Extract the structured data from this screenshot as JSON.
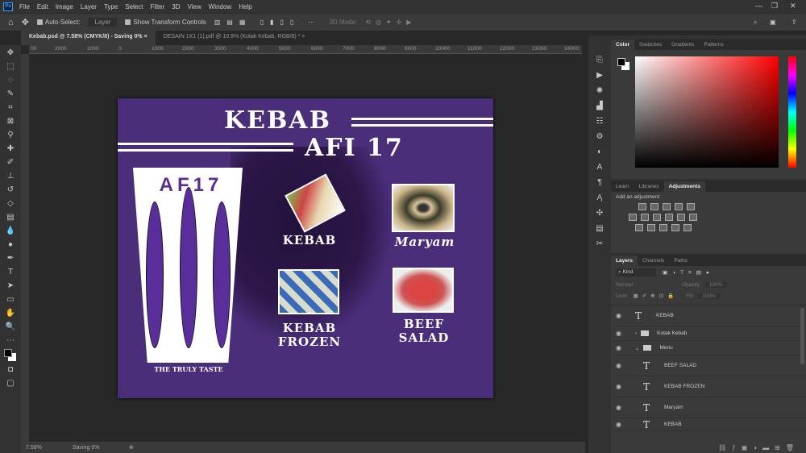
{
  "menubar": {
    "logo": "Ps",
    "items": [
      "File",
      "Edit",
      "Image",
      "Layer",
      "Type",
      "Select",
      "Filter",
      "3D",
      "View",
      "Window",
      "Help"
    ]
  },
  "options": {
    "auto_select": "Auto-Select:",
    "auto_select_target": "Layer",
    "show_transform": "Show Transform Controls",
    "mode_3d": "3D Mode:"
  },
  "tabs": [
    {
      "label": "Kebab.psd @ 7.58% (CMYK/8) - Saving 0%",
      "active": true
    },
    {
      "label": "DESAIN 1X1 (1).pdf @ 10.9% (Kotak Kebab, RGB/8) *",
      "active": false
    }
  ],
  "ruler": [
    "00",
    "2000",
    "1000",
    "0",
    "1000",
    "2000",
    "3000",
    "4000",
    "5000",
    "6000",
    "7000",
    "8000",
    "9000",
    "10000",
    "11000",
    "12000",
    "13000",
    "14000"
  ],
  "document": {
    "title_line1": "KEBAB",
    "title_line2": "AFI 17",
    "logo_text": "AF17",
    "tagline": "THE TRULY TASTE",
    "menu": [
      "KEBAB",
      "Maryam",
      "KEBAB FROZEN",
      "BEEF SALAD"
    ],
    "bg_color": "#4a2e7a"
  },
  "status": {
    "zoom": "7.58%",
    "saving": "Saving 0%"
  },
  "color_panel": {
    "tabs": [
      "Color",
      "Swatches",
      "Gradients",
      "Patterns"
    ],
    "hue": "#ff0000"
  },
  "adjust_panel": {
    "tabs": [
      "Learn",
      "Libraries",
      "Adjustments"
    ],
    "hint": "Add an adjustment"
  },
  "layers_panel": {
    "tabs": [
      "Layers",
      "Channels",
      "Paths"
    ],
    "filter": "Kind",
    "blend": "Normal",
    "opacity_label": "Opacity:",
    "opacity": "100%",
    "lock_label": "Lock:",
    "fill_label": "Fill:",
    "fill": "100%",
    "layers": [
      {
        "name": "KEBAB",
        "type": "text",
        "indent": 0
      },
      {
        "name": "Kotak Kebab",
        "type": "group",
        "indent": 0
      },
      {
        "name": "Menu",
        "type": "group-open",
        "indent": 0
      },
      {
        "name": "BEEF SALAD",
        "type": "text",
        "indent": 1
      },
      {
        "name": "KEBAB FROZEN",
        "type": "text",
        "indent": 1
      },
      {
        "name": "Maryam",
        "type": "text",
        "indent": 1
      },
      {
        "name": "KEBAB",
        "type": "text",
        "indent": 1
      }
    ]
  }
}
